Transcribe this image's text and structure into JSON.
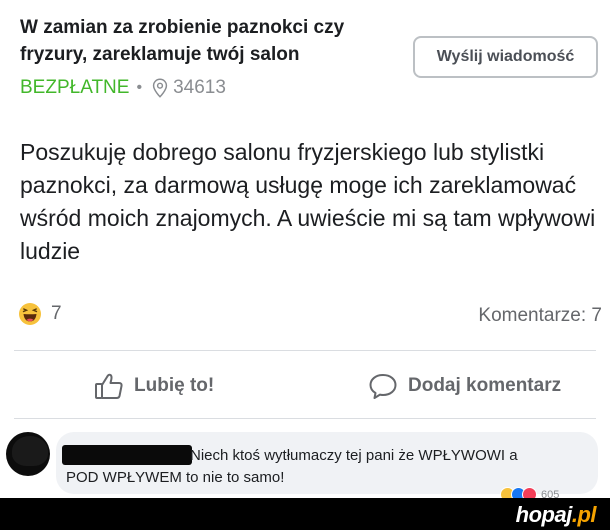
{
  "listing": {
    "title": "W zamian za zrobienie paznokci czy fryzury, zareklamuje twój salon",
    "price": "BEZPŁATNE",
    "separator": "•",
    "location": "34613",
    "send_message_label": "Wyślij wiadomość",
    "price_color": "#42b72a"
  },
  "post": {
    "body": "Poszukuję dobrego salonu fryzjerskiego lub stylistki paznokci,  za darmową usługę moge ich zareklamować wśród moich znajomych. A uwieście mi są tam wpływowi ludzie"
  },
  "reactions": {
    "count": "7",
    "type": "haha",
    "comments_label": "Komentarze: 7"
  },
  "actions": {
    "like_label": "Lubię to!",
    "comment_label": "Dodaj komentarz"
  },
  "comment": {
    "text_line1": "Niech ktoś wytłumaczy tej pani że WPŁYWOWI a",
    "text_line2": "POD WPŁYWEM to nie to samo!",
    "reactions_count": "605"
  },
  "watermark": {
    "name": "hopaj",
    "tld": ".pl"
  }
}
